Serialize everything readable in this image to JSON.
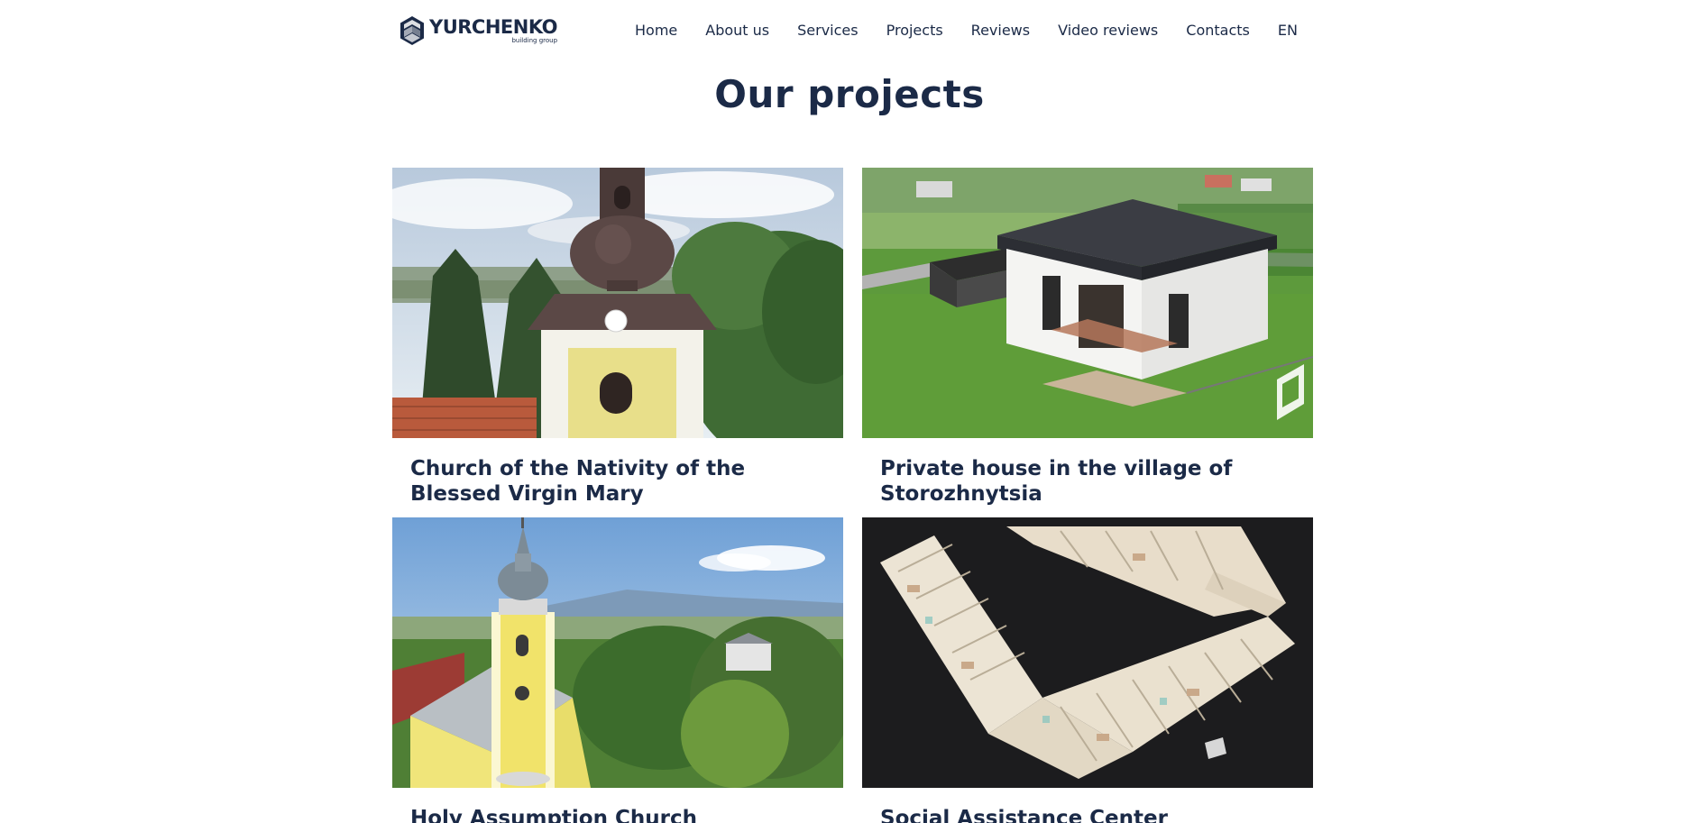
{
  "header": {
    "logo": {
      "name": "YURCHENKO",
      "subtitle": "building group"
    },
    "nav": [
      {
        "label": "Home"
      },
      {
        "label": "About us"
      },
      {
        "label": "Services"
      },
      {
        "label": "Projects"
      },
      {
        "label": "Reviews"
      },
      {
        "label": "Video reviews"
      },
      {
        "label": "Contacts"
      },
      {
        "label": "EN"
      }
    ]
  },
  "main": {
    "title": "Our projects",
    "projects": [
      {
        "title": "Church of the Nativity of the Blessed Virgin Mary",
        "image": "church-tower-photo"
      },
      {
        "title": "Private house in the village of Storozhnytsia",
        "image": "private-house-aerial-photo"
      },
      {
        "title": "Holy Assumption Church",
        "image": "yellow-church-aerial-photo"
      },
      {
        "title": "Social Assistance Center",
        "image": "3d-floor-plan-render"
      }
    ]
  },
  "colors": {
    "brand": "#1b2a47",
    "background": "#ffffff"
  }
}
